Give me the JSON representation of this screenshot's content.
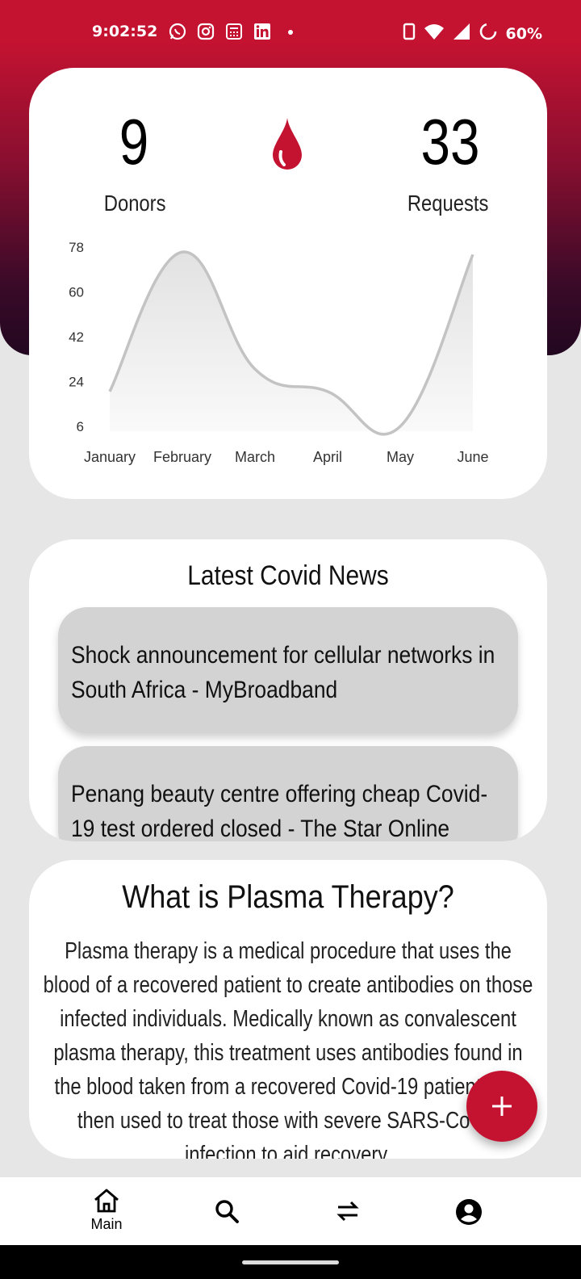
{
  "status_bar": {
    "time": "9:02:52",
    "notification_icons": [
      "whatsapp-icon",
      "instagram-icon",
      "calculator-icon",
      "linkedin-icon",
      "dot-icon"
    ],
    "battery": "60%"
  },
  "stats": {
    "donors_count": "9",
    "donors_label": "Donors",
    "requests_count": "33",
    "requests_label": "Requests"
  },
  "chart_data": {
    "type": "area",
    "categories": [
      "January",
      "February",
      "March",
      "April",
      "May",
      "June"
    ],
    "values": [
      20,
      76,
      29,
      20,
      6,
      75
    ],
    "yticks": [
      78,
      60,
      42,
      24,
      6
    ],
    "ylim": [
      6,
      78
    ],
    "line_color": "#c3c3c3",
    "grid": false
  },
  "news": {
    "title": "Latest Covid News",
    "items": [
      "Shock announcement for cellular networks in South Africa - MyBroadband",
      "Penang beauty centre offering cheap Covid-19 test ordered closed - The Star Online"
    ]
  },
  "plasma": {
    "title": "What is Plasma Therapy?",
    "body": "Plasma therapy is a medical procedure that uses the blood of a recovered patient to create antibodies on those infected individuals. Medically known as convalescent plasma therapy, this treatment uses antibodies found in the blood taken from a recovered Covid-19 patient. It is then used to treat those with severe SARS-CoV-2 infection to aid recovery."
  },
  "nav": {
    "main_label": "Main"
  },
  "colors": {
    "accent": "#c41231"
  }
}
